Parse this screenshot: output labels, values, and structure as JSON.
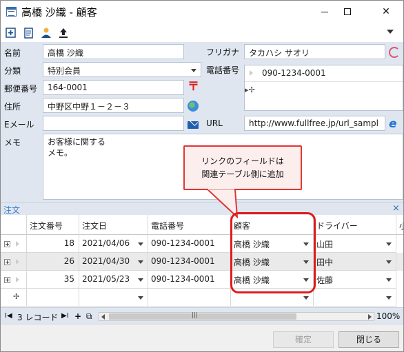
{
  "window": {
    "title": "高橋 沙織 - 顧客"
  },
  "form": {
    "name_label": "名前",
    "name_value": "高橋 沙織",
    "furigana_label": "フリガナ",
    "furigana_value": "タカハシ サオリ",
    "category_label": "分類",
    "category_value": "特別会員",
    "phone_label": "電話番号",
    "phone_value": "090-1234-0001",
    "zip_label": "郵便番号",
    "zip_value": "164-0001",
    "postal_symbol": "〒",
    "address_label": "住所",
    "address_value": "中野区中野１－２－３",
    "email_label": "Eメール",
    "email_value": "",
    "url_label": "URL",
    "url_value": "http://www.fullfree.jp/url_sampl",
    "memo_label": "メモ",
    "memo_value": "お客様に関する\nメモ。"
  },
  "callout": {
    "line1": "リンクのフィールドは",
    "line2": "関連テーブル側に追加"
  },
  "subform": {
    "title": "注文",
    "close": "×",
    "columns": [
      "注文番号",
      "注文日",
      "電話番号",
      "顧客",
      "ドライバー",
      "小"
    ],
    "rows": [
      {
        "order_no": "18",
        "date": "2021/04/06",
        "phone": "090-1234-0001",
        "customer": "高橋 沙織",
        "driver": "山田"
      },
      {
        "order_no": "26",
        "date": "2021/04/30",
        "phone": "090-1234-0001",
        "customer": "高橋 沙織",
        "driver": "田中"
      },
      {
        "order_no": "35",
        "date": "2021/05/23",
        "phone": "090-1234-0001",
        "customer": "高橋 沙織",
        "driver": "佐藤"
      }
    ]
  },
  "navbar": {
    "first": "I◀",
    "count_text": "3 レコード",
    "last": "▶I",
    "add": "+",
    "copy": "⧉",
    "zoom": "100%",
    "grip": "|||"
  },
  "footer": {
    "confirm": "確定",
    "close": "閉じる"
  }
}
